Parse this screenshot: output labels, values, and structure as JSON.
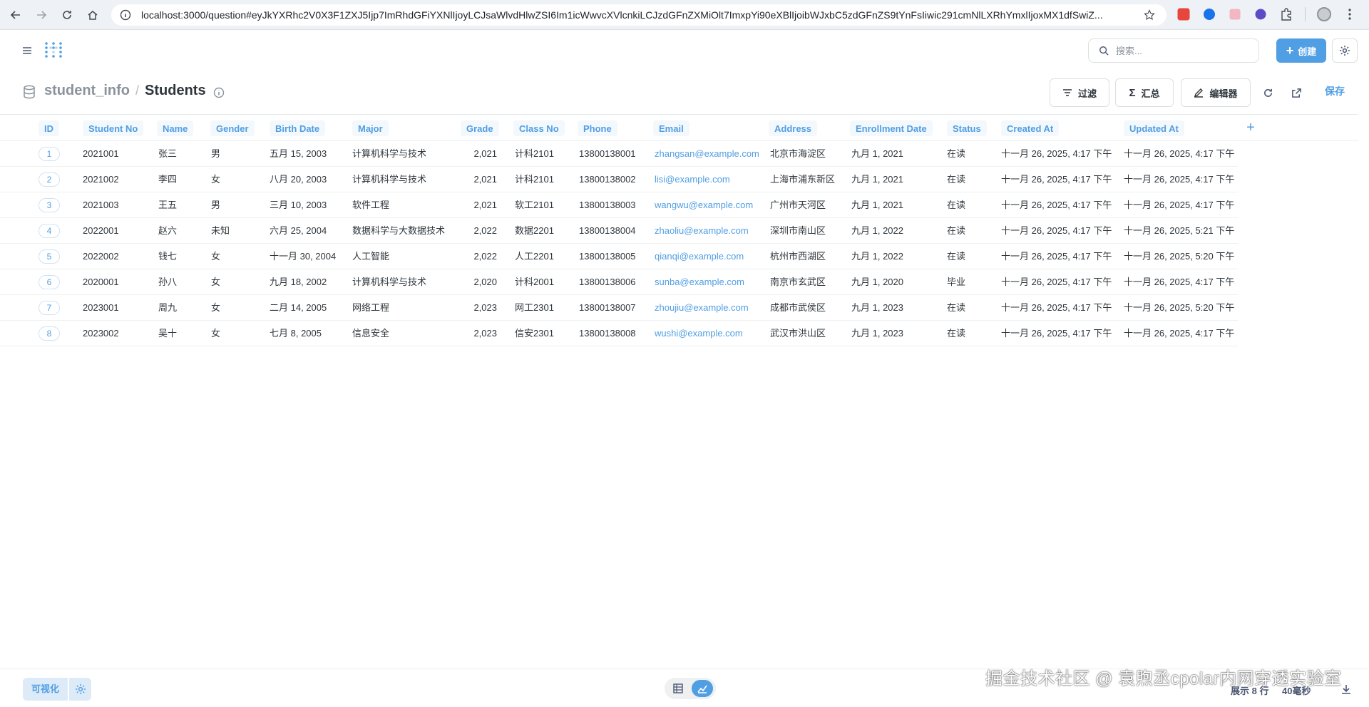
{
  "browser": {
    "url": "localhost:3000/question#eyJkYXRhc2V0X3F1ZXJ5Ijp7ImRhdGFiYXNlIjoyLCJsaWlvdHlwZSI6Im1icWwvcXVlcnkiLCJzdGFnZXMiOlt7ImxpYi90eXBlIjoibWJxbC5zdGFnZS9tYnFsIiwic291cmNlLXRhYmxlIjoxMX1dfSwiZ..."
  },
  "header": {
    "search_placeholder": "搜索...",
    "create_label": "创建"
  },
  "question": {
    "database": "student_info",
    "separator": "/",
    "table": "Students",
    "filter_label": "过滤",
    "summarize_label": "汇总",
    "editor_label": "编辑器",
    "save_label": "保存"
  },
  "table": {
    "columns": [
      "ID",
      "Student No",
      "Name",
      "Gender",
      "Birth Date",
      "Major",
      "Grade",
      "Class No",
      "Phone",
      "Email",
      "Address",
      "Enrollment Date",
      "Status",
      "Created At",
      "Updated At"
    ],
    "rows": [
      [
        "1",
        "2021001",
        "张三",
        "男",
        "五月 15, 2003",
        "计算机科学与技术",
        "2,021",
        "计科2101",
        "13800138001",
        "zhangsan@example.com",
        "北京市海淀区",
        "九月 1, 2021",
        "在读",
        "十一月 26, 2025, 4:17 下午",
        "十一月 26, 2025, 4:17 下午"
      ],
      [
        "2",
        "2021002",
        "李四",
        "女",
        "八月 20, 2003",
        "计算机科学与技术",
        "2,021",
        "计科2101",
        "13800138002",
        "lisi@example.com",
        "上海市浦东新区",
        "九月 1, 2021",
        "在读",
        "十一月 26, 2025, 4:17 下午",
        "十一月 26, 2025, 4:17 下午"
      ],
      [
        "3",
        "2021003",
        "王五",
        "男",
        "三月 10, 2003",
        "软件工程",
        "2,021",
        "软工2101",
        "13800138003",
        "wangwu@example.com",
        "广州市天河区",
        "九月 1, 2021",
        "在读",
        "十一月 26, 2025, 4:17 下午",
        "十一月 26, 2025, 4:17 下午"
      ],
      [
        "4",
        "2022001",
        "赵六",
        "未知",
        "六月 25, 2004",
        "数据科学与大数据技术",
        "2,022",
        "数据2201",
        "13800138004",
        "zhaoliu@example.com",
        "深圳市南山区",
        "九月 1, 2022",
        "在读",
        "十一月 26, 2025, 4:17 下午",
        "十一月 26, 2025, 5:21 下午"
      ],
      [
        "5",
        "2022002",
        "钱七",
        "女",
        "十一月 30, 2004",
        "人工智能",
        "2,022",
        "人工2201",
        "13800138005",
        "qianqi@example.com",
        "杭州市西湖区",
        "九月 1, 2022",
        "在读",
        "十一月 26, 2025, 4:17 下午",
        "十一月 26, 2025, 5:20 下午"
      ],
      [
        "6",
        "2020001",
        "孙八",
        "女",
        "九月 18, 2002",
        "计算机科学与技术",
        "2,020",
        "计科2001",
        "13800138006",
        "sunba@example.com",
        "南京市玄武区",
        "九月 1, 2020",
        "毕业",
        "十一月 26, 2025, 4:17 下午",
        "十一月 26, 2025, 4:17 下午"
      ],
      [
        "7",
        "2023001",
        "周九",
        "女",
        "二月 14, 2005",
        "网络工程",
        "2,023",
        "网工2301",
        "13800138007",
        "zhoujiu@example.com",
        "成都市武侯区",
        "九月 1, 2023",
        "在读",
        "十一月 26, 2025, 4:17 下午",
        "十一月 26, 2025, 5:20 下午"
      ],
      [
        "8",
        "2023002",
        "吴十",
        "女",
        "七月 8, 2005",
        "信息安全",
        "2,023",
        "信安2301",
        "13800138008",
        "wushi@example.com",
        "武汉市洪山区",
        "九月 1, 2023",
        "在读",
        "十一月 26, 2025, 4:17 下午",
        "十一月 26, 2025, 4:17 下午"
      ]
    ]
  },
  "footer": {
    "visualize_label": "可视化",
    "row_count": "展示 8 行",
    "timing": "40毫秒"
  },
  "watermark": "掘金技术社区 @ 袁煦丞cpolar内网穿透实验室",
  "colors": {
    "brand": "#509ee3",
    "text": "#2e353b",
    "muted": "#8a939c"
  }
}
